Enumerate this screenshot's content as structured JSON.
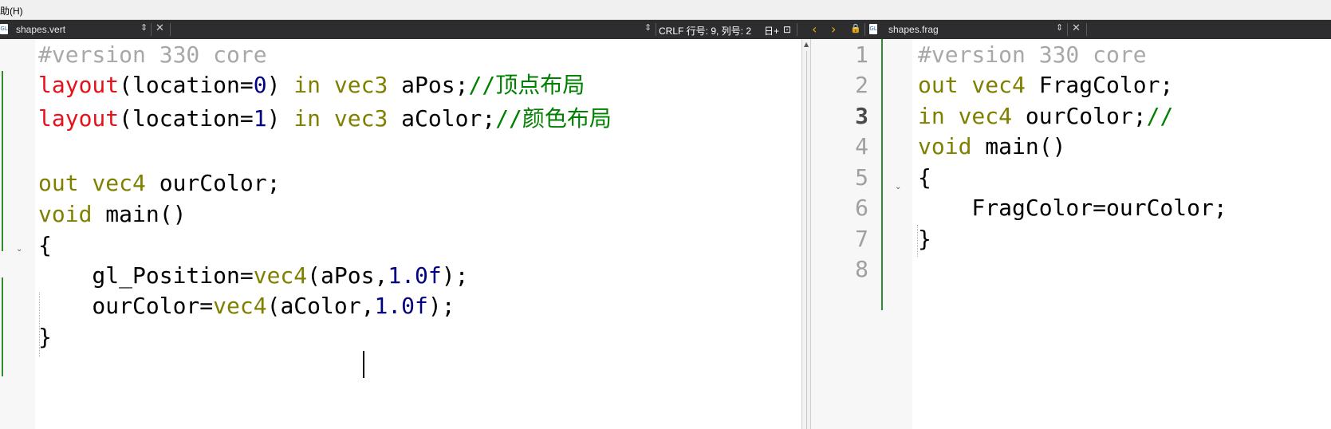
{
  "menubar": {
    "help_label": "助(H)"
  },
  "left_tab": {
    "icon": "glsl-file-icon",
    "icon_text": "GL",
    "file_name": "shapes.vert",
    "updown": "⇕",
    "close": "✕",
    "status": "CRLF  行号: 9, 列号: 2",
    "status_icon_1": "日+",
    "status_icon_2": "⊡"
  },
  "right_tab": {
    "icon": "glsl-file-icon",
    "icon_text": "GL",
    "file_name": "shapes.frag",
    "updown": "⇕",
    "close": "✕",
    "prev": "‹",
    "next": "›",
    "lock": "🔒"
  },
  "left_editor": {
    "lines": [
      {
        "segments": [
          {
            "cls": "c-gray",
            "text": "#version 330 core"
          }
        ]
      },
      {
        "segments": [
          {
            "cls": "c-red",
            "text": "layout"
          },
          {
            "cls": "c-dark",
            "text": "(location="
          },
          {
            "cls": "c-num",
            "text": "0"
          },
          {
            "cls": "c-dark",
            "text": ") "
          },
          {
            "cls": "c-olive",
            "text": "in vec3"
          },
          {
            "cls": "c-dark",
            "text": " aPos;"
          },
          {
            "cls": "c-green",
            "text": "//顶点布局"
          }
        ]
      },
      {
        "segments": [
          {
            "cls": "c-red",
            "text": "layout"
          },
          {
            "cls": "c-dark",
            "text": "(location="
          },
          {
            "cls": "c-num",
            "text": "1"
          },
          {
            "cls": "c-dark",
            "text": ") "
          },
          {
            "cls": "c-olive",
            "text": "in vec3"
          },
          {
            "cls": "c-dark",
            "text": " aColor;"
          },
          {
            "cls": "c-green",
            "text": "//颜色布局"
          }
        ]
      },
      {
        "segments": []
      },
      {
        "segments": [
          {
            "cls": "c-olive",
            "text": "out vec4"
          },
          {
            "cls": "c-dark",
            "text": " ourColor;"
          }
        ]
      },
      {
        "segments": [
          {
            "cls": "c-olive",
            "text": "void"
          },
          {
            "cls": "c-dark",
            "text": " main()"
          }
        ]
      },
      {
        "segments": [
          {
            "cls": "c-dark",
            "text": "{"
          }
        ]
      },
      {
        "segments": [
          {
            "cls": "c-dark",
            "text": "    gl_Position="
          },
          {
            "cls": "c-olive",
            "text": "vec4"
          },
          {
            "cls": "c-dark",
            "text": "(aPos,"
          },
          {
            "cls": "c-num",
            "text": "1.0f"
          },
          {
            "cls": "c-dark",
            "text": ");"
          }
        ]
      },
      {
        "segments": [
          {
            "cls": "c-dark",
            "text": "    ourColor="
          },
          {
            "cls": "c-olive",
            "text": "vec4"
          },
          {
            "cls": "c-dark",
            "text": "(aColor,"
          },
          {
            "cls": "c-num",
            "text": "1.0f"
          },
          {
            "cls": "c-dark",
            "text": ");"
          }
        ]
      },
      {
        "segments": [
          {
            "cls": "c-dark",
            "text": "}"
          }
        ]
      }
    ]
  },
  "right_editor": {
    "line_numbers": [
      "1",
      "2",
      "3",
      "4",
      "5",
      "6",
      "7",
      "8"
    ],
    "current_line": "3",
    "lines": [
      {
        "segments": [
          {
            "cls": "c-gray",
            "text": "#version 330 core"
          }
        ]
      },
      {
        "segments": [
          {
            "cls": "c-olive",
            "text": "out vec4"
          },
          {
            "cls": "c-dark",
            "text": " FragColor;"
          }
        ]
      },
      {
        "segments": [
          {
            "cls": "c-olive",
            "text": "in vec4"
          },
          {
            "cls": "c-dark",
            "text": " ourColor;"
          },
          {
            "cls": "c-green",
            "text": "//"
          }
        ]
      },
      {
        "segments": [
          {
            "cls": "c-olive",
            "text": "void"
          },
          {
            "cls": "c-dark",
            "text": " main()"
          }
        ]
      },
      {
        "segments": [
          {
            "cls": "c-dark",
            "text": "{"
          }
        ]
      },
      {
        "segments": [
          {
            "cls": "c-dark",
            "text": "    FragColor=ourColor;"
          }
        ]
      },
      {
        "segments": [
          {
            "cls": "c-dark",
            "text": "}"
          }
        ]
      },
      {
        "segments": []
      }
    ]
  },
  "colors": {
    "keyword": "#808000",
    "layout_keyword": "#e8101a",
    "number": "#000080",
    "comment": "#008000",
    "preprocessor": "#a8a8a8",
    "change_bar": "#2e8b2e",
    "tab_bar_bg": "#2d2d30"
  }
}
